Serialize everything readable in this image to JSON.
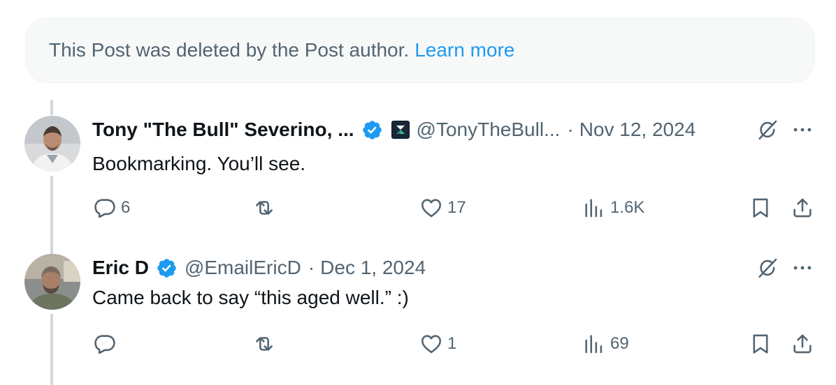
{
  "deleted_notice": {
    "text": "This Post was deleted by the Post author.",
    "link": "Learn more"
  },
  "colors": {
    "accent": "#1d9bf0",
    "secondary_text": "#536471",
    "verified_badge": "#1d9bf0"
  },
  "replies": [
    {
      "name": "Tony \"The Bull\" Severino, ...",
      "verified": true,
      "affiliate_badge": "affiliate-badge-icon",
      "handle": "@TonyTheBull...",
      "separator": "·",
      "date": "Nov 12, 2024",
      "text": "Bookmarking. You’ll see.",
      "actions": {
        "replies": "6",
        "reposts": "",
        "likes": "17",
        "views": "1.6K"
      }
    },
    {
      "name": "Eric D",
      "verified": true,
      "handle": "@EmailEricD",
      "separator": "·",
      "date": "Dec 1, 2024",
      "text": "Came back to say “this aged well.” :)",
      "actions": {
        "replies": "",
        "reposts": "",
        "likes": "1",
        "views": "69"
      }
    }
  ]
}
